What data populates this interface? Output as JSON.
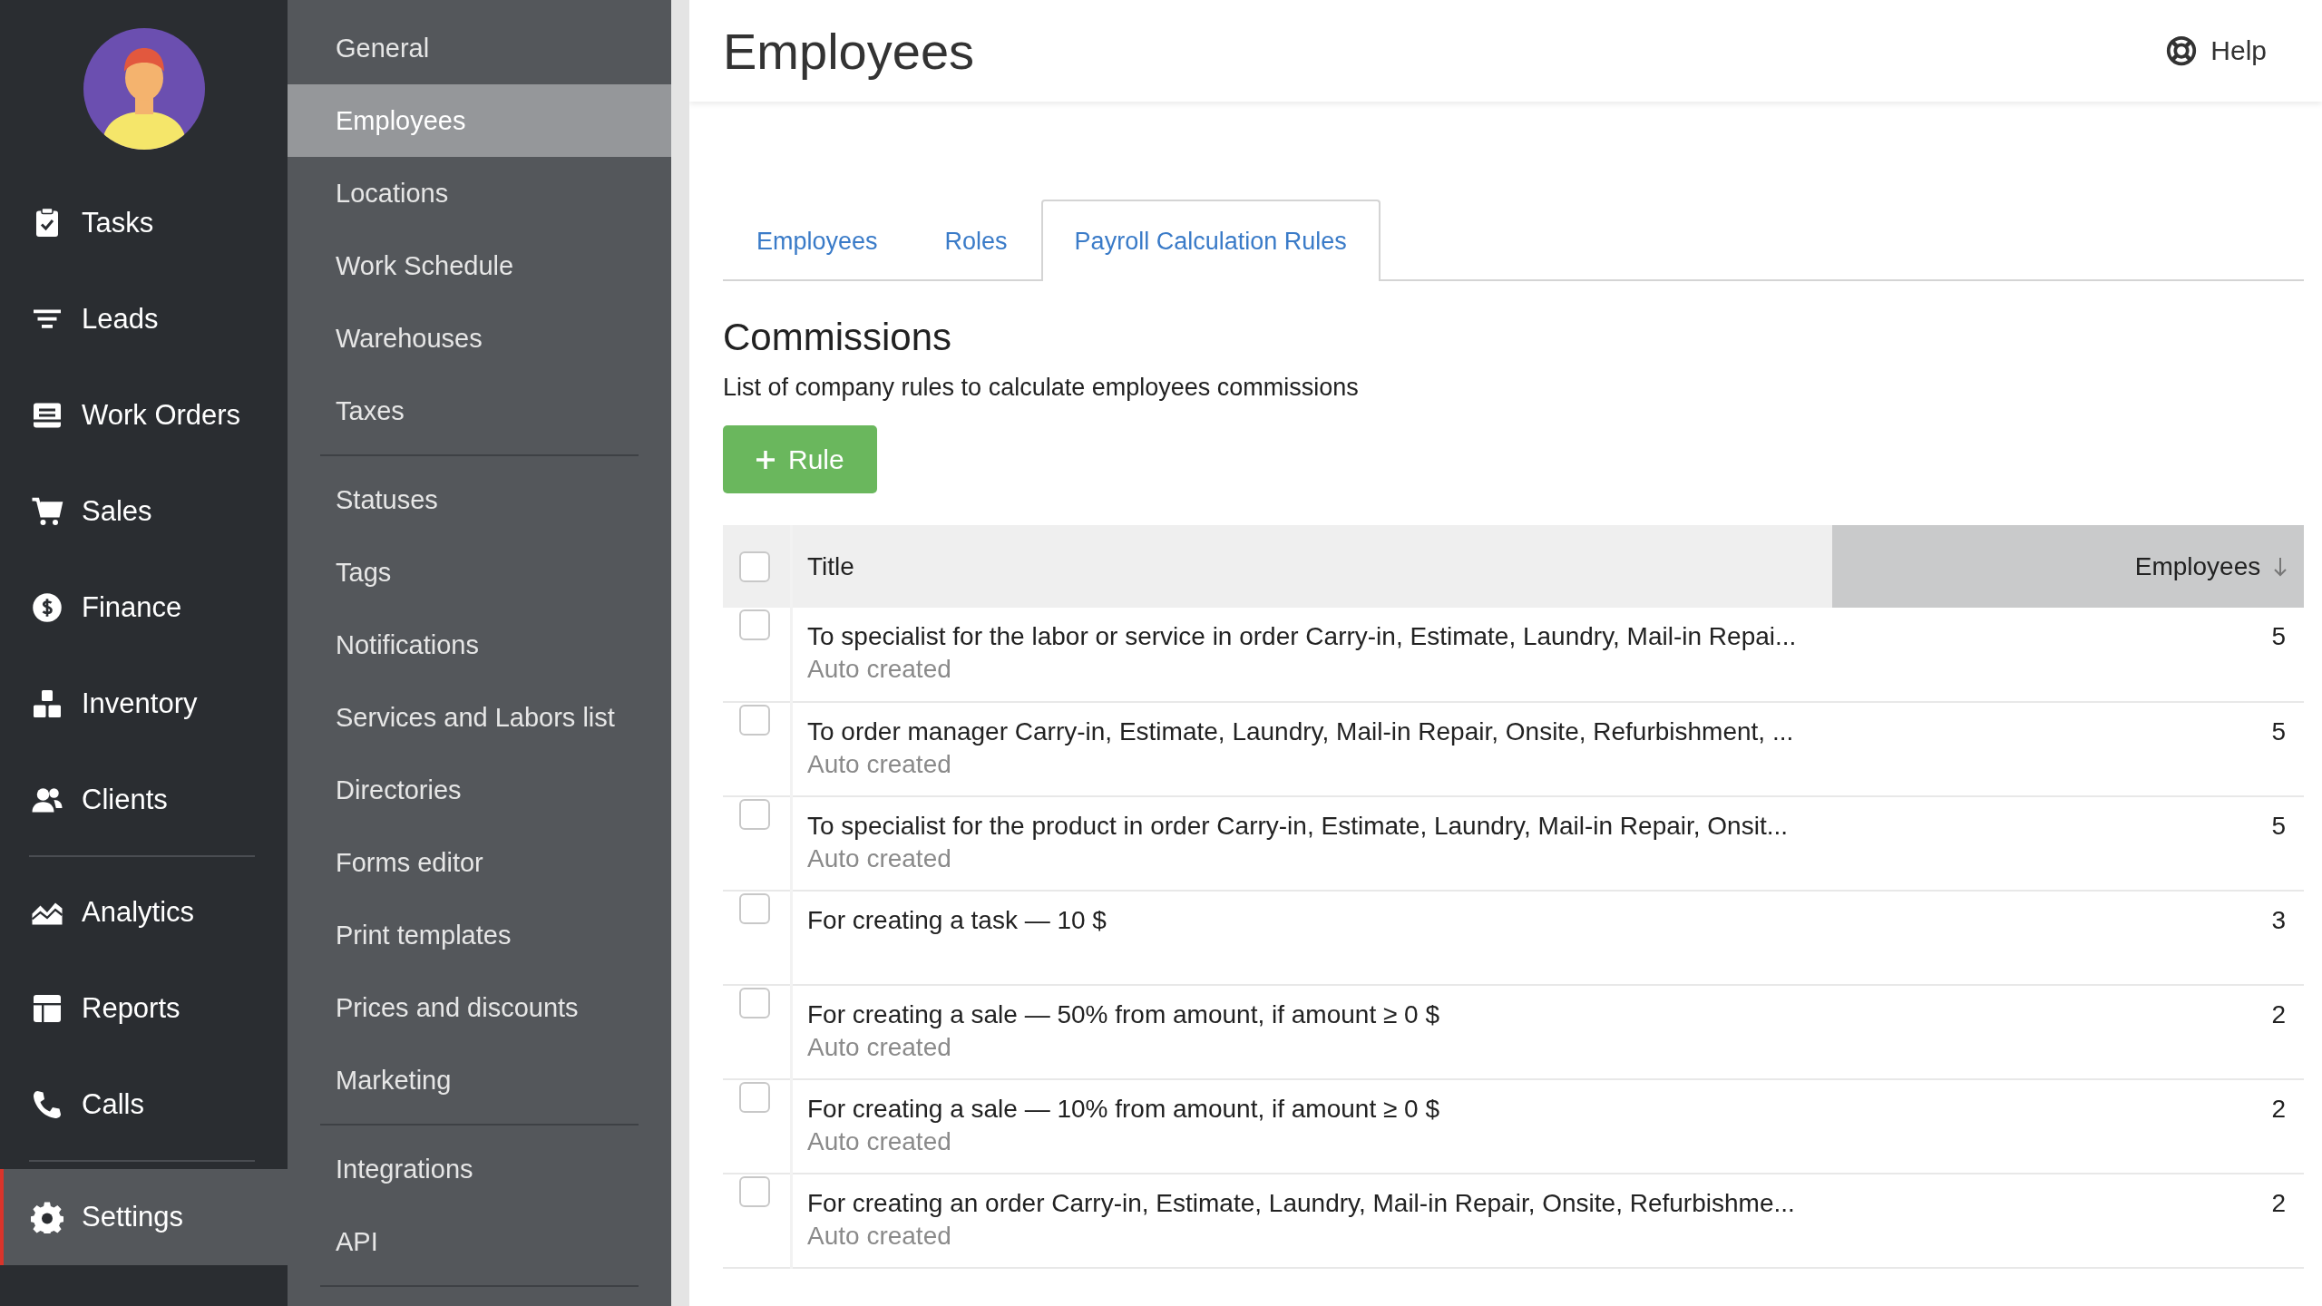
{
  "main_nav": {
    "groups": [
      {
        "items": [
          {
            "label": "Tasks",
            "selected": false
          },
          {
            "label": "Leads",
            "selected": false
          },
          {
            "label": "Work Orders",
            "selected": false
          },
          {
            "label": "Sales",
            "selected": false
          },
          {
            "label": "Finance",
            "selected": false
          },
          {
            "label": "Inventory",
            "selected": false
          },
          {
            "label": "Clients",
            "selected": false
          }
        ]
      },
      {
        "items": [
          {
            "label": "Analytics",
            "selected": false
          },
          {
            "label": "Reports",
            "selected": false
          },
          {
            "label": "Calls",
            "selected": false
          }
        ]
      },
      {
        "items": [
          {
            "label": "Settings",
            "selected": true
          }
        ]
      }
    ]
  },
  "settings_nav": {
    "groups": [
      {
        "items": [
          {
            "label": "General",
            "selected": false
          },
          {
            "label": "Employees",
            "selected": true
          },
          {
            "label": "Locations",
            "selected": false
          },
          {
            "label": "Work Schedule",
            "selected": false
          },
          {
            "label": "Warehouses",
            "selected": false
          },
          {
            "label": "Taxes",
            "selected": false
          }
        ]
      },
      {
        "items": [
          {
            "label": "Statuses",
            "selected": false
          },
          {
            "label": "Tags",
            "selected": false
          },
          {
            "label": "Notifications",
            "selected": false
          },
          {
            "label": "Services and Labors list",
            "selected": false
          },
          {
            "label": "Directories",
            "selected": false
          },
          {
            "label": "Forms editor",
            "selected": false
          },
          {
            "label": "Print templates",
            "selected": false
          },
          {
            "label": "Prices and discounts",
            "selected": false
          },
          {
            "label": "Marketing",
            "selected": false
          }
        ]
      },
      {
        "items": [
          {
            "label": "Integrations",
            "selected": false
          },
          {
            "label": "API",
            "selected": false
          }
        ]
      }
    ]
  },
  "header": {
    "title": "Employees",
    "help": "Help"
  },
  "tabs": [
    {
      "label": "Employees",
      "selected": false
    },
    {
      "label": "Roles",
      "selected": false
    },
    {
      "label": "Payroll Calculation Rules",
      "selected": true
    }
  ],
  "section": {
    "title": "Commissions",
    "description": "List of company rules to calculate employees commissions",
    "add_button": "Rule"
  },
  "table": {
    "select_all_checked": false,
    "columns": [
      {
        "label": "Title",
        "sorted": false
      },
      {
        "label": "Employees",
        "sorted": true
      }
    ],
    "rows": [
      {
        "checked": false,
        "title": "To specialist for the labor or service in order Carry-in, Estimate, Laundry, Mail-in Repai...",
        "note": "Auto created",
        "employees": "5"
      },
      {
        "checked": false,
        "title": "To order manager Carry-in, Estimate, Laundry, Mail-in Repair, Onsite, Refurbishment, ...",
        "note": "Auto created",
        "employees": "5"
      },
      {
        "checked": false,
        "title": "To specialist for the product in order Carry-in, Estimate, Laundry, Mail-in Repair, Onsit...",
        "note": "Auto created",
        "employees": "5"
      },
      {
        "checked": false,
        "title": "For creating a task — 10 $",
        "employees": "3"
      },
      {
        "checked": false,
        "title": "For creating a sale — 50% from amount, if amount ≥ 0 $",
        "note": "Auto created",
        "employees": "2"
      },
      {
        "checked": false,
        "title": "For creating a sale — 10% from amount, if amount ≥ 0 $",
        "note": "Auto created",
        "employees": "2"
      },
      {
        "checked": false,
        "title": "For creating an order Carry-in, Estimate, Laundry, Mail-in Repair, Onsite, Refurbishme...",
        "note": "Auto created",
        "employees": "2"
      }
    ]
  }
}
